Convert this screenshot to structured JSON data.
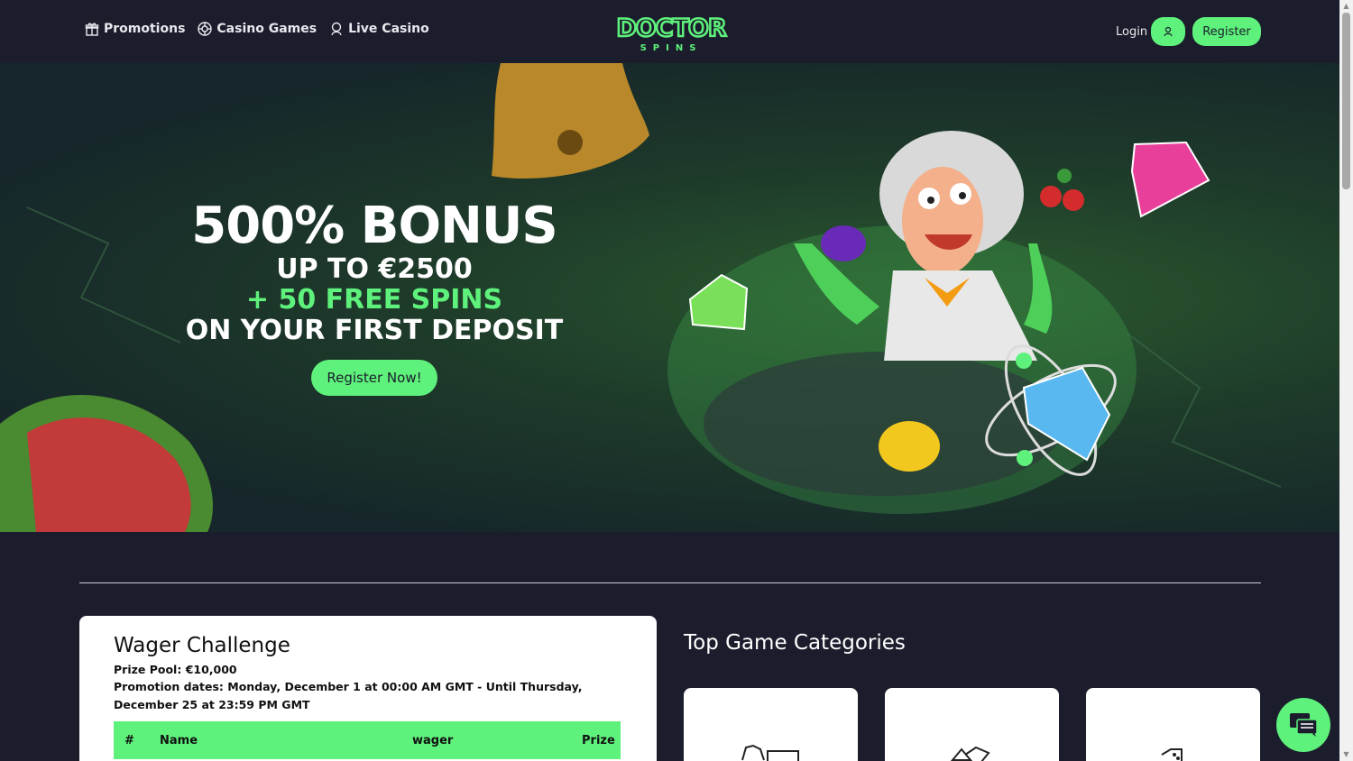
{
  "nav": {
    "promotions": "Promotions",
    "casino_games": "Casino Games",
    "live_casino": "Live Casino"
  },
  "logo": {
    "line1": "DOCTOR",
    "line2": "SPINS"
  },
  "auth": {
    "login": "Login",
    "register": "Register"
  },
  "hero": {
    "headline": "500% BONUS",
    "line1": "UP TO €2500",
    "line2": "+ 50 FREE SPINS",
    "line3": "ON YOUR FIRST DEPOSIT",
    "cta": "Register Now!"
  },
  "wager": {
    "title": "Wager Challenge",
    "prize_pool": "Prize Pool: €10,000",
    "dates": "Promotion dates: Monday, December 1 at 00:00 AM GMT - Until Thursday, December 25 at 23:59 PM GMT",
    "table_headers": [
      "#",
      "Name",
      "wager",
      "Prize"
    ]
  },
  "categories": {
    "title": "Top Game Categories"
  },
  "colors": {
    "accent": "#5ef17b",
    "background": "#1b1d2c",
    "card": "#ffffff"
  }
}
